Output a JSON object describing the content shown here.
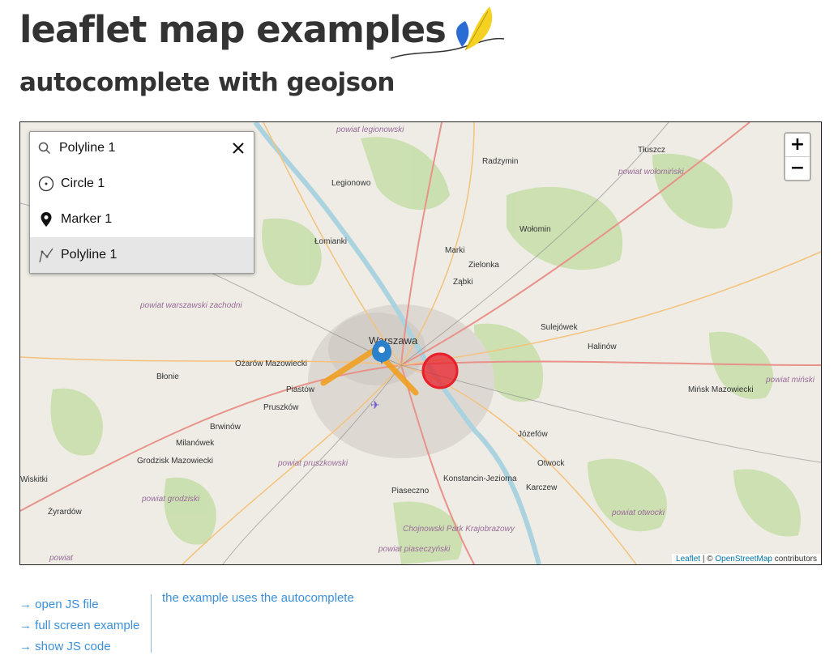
{
  "header": {
    "title": "leaflet map examples",
    "subtitle": "autocomplete with geojson"
  },
  "autocomplete": {
    "value": "Polyline 1",
    "results": [
      {
        "label": "Circle 1",
        "icon": "circle-icon"
      },
      {
        "label": "Marker 1",
        "icon": "marker-icon"
      },
      {
        "label": "Polyline 1",
        "icon": "polyline-icon",
        "active": true
      }
    ]
  },
  "zoom": {
    "in_label": "+",
    "out_label": "−"
  },
  "attribution": {
    "leaflet_link": "Leaflet",
    "separator": " | © ",
    "osm_link": "OpenStreetMap",
    "suffix": " contributors"
  },
  "places": [
    "powiat legionowski",
    "Tłuszcz",
    "Radzymin",
    "powiat wołomiński",
    "Legionowo",
    "Wołomin",
    "Łomianki",
    "Marki",
    "Zielonka",
    "Ząbki",
    "powiat warszawski zachodni",
    "Sulejówek",
    "Warszawa",
    "Halinów",
    "Ożarów Mazowiecki",
    "Błonie",
    "Piastów",
    "powiat miński",
    "Mińsk Mazowiecki",
    "Pruszków",
    "Brwinów",
    "Józefów",
    "Milanówek",
    "Grodzisk Mazowiecki",
    "powiat pruszkowski",
    "Otwock",
    "Wiskitki",
    "Konstancin-Jeziorna",
    "Piaseczno",
    "Karczew",
    "powiat grodziski",
    "Żyrardów",
    "Chojnowski Park Krajobrazowy",
    "powiat otwocki",
    "powiat piaseczyński",
    "powiat"
  ],
  "links": [
    "→ open JS file",
    "→ full screen example",
    "→ show JS code"
  ],
  "description": "the example uses the autocomplete",
  "colors": {
    "circle": "#e8202a",
    "polyline": "#f0a020",
    "marker": "#2a81cb",
    "link": "#3b8fd9"
  }
}
